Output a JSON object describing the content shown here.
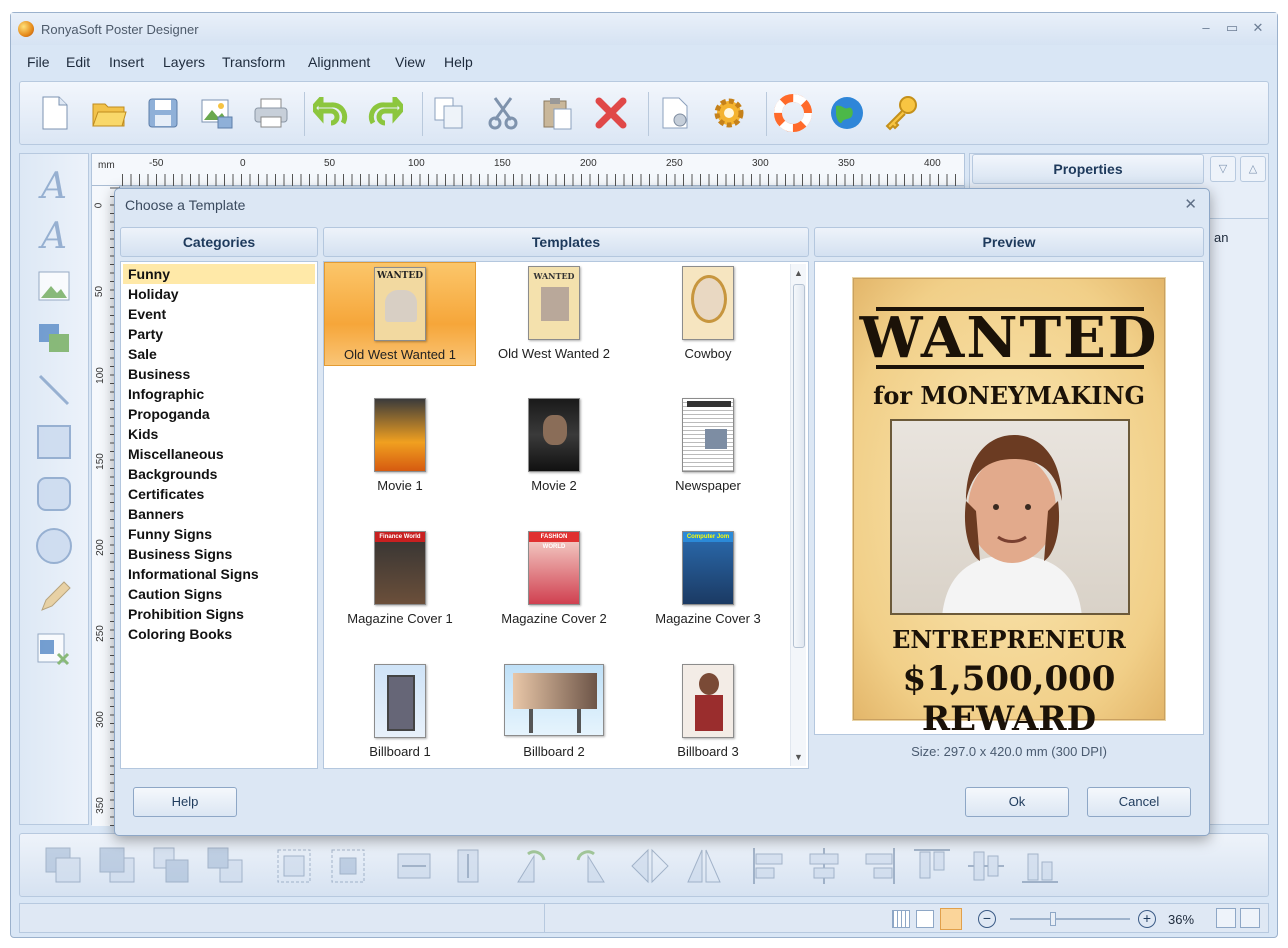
{
  "app": {
    "title": "RonyaSoft Poster Designer"
  },
  "menu": [
    "File",
    "Edit",
    "Insert",
    "Layers",
    "Transform",
    "Alignment",
    "View",
    "Help"
  ],
  "toolbar": {
    "icons": [
      "new-document-icon",
      "open-folder-icon",
      "save-icon",
      "export-image-icon",
      "print-icon",
      "undo-icon",
      "redo-icon",
      "copy-icon",
      "cut-icon",
      "paste-icon",
      "delete-icon",
      "page-settings-icon",
      "options-gear-icon",
      "help-lifebuoy-icon",
      "web-globe-icon",
      "register-key-icon"
    ]
  },
  "ruler": {
    "unit": "mm",
    "h_labels": [
      "-50",
      "0",
      "50",
      "100",
      "150",
      "200",
      "250",
      "300",
      "350",
      "400"
    ],
    "v_labels": [
      "0",
      "50",
      "100",
      "150",
      "200",
      "250",
      "300",
      "350"
    ]
  },
  "properties": {
    "title": "Properties",
    "fragment": "an"
  },
  "dialog": {
    "title": "Choose a Template",
    "headers": {
      "categories": "Categories",
      "templates": "Templates",
      "preview": "Preview"
    },
    "categories": [
      "Funny",
      "Holiday",
      "Event",
      "Party",
      "Sale",
      "Business",
      "Infographic",
      "Propoganda",
      "Kids",
      "Miscellaneous",
      "Backgrounds",
      "Certificates",
      "Banners",
      "Funny Signs",
      "Business Signs",
      "Informational Signs",
      "Caution Signs",
      "Prohibition Signs",
      "Coloring Books"
    ],
    "selected_category": "Funny",
    "templates": [
      "Old West Wanted 1",
      "Old West Wanted 2",
      "Cowboy",
      "Movie 1",
      "Movie 2",
      "Newspaper",
      "Magazine Cover 1",
      "Magazine Cover 2",
      "Magazine Cover 3",
      "Billboard 1",
      "Billboard 2",
      "Billboard 3"
    ],
    "selected_template": "Old West Wanted 1",
    "preview": {
      "headline": "WANTED",
      "sub": "for MONEYMAKING",
      "occupation": "ENTREPRENEUR",
      "reward": "$1,500,000 REWARD"
    },
    "thumb_text": {
      "wanted": "WANTED",
      "finance": "Finance World",
      "fashion": "FASHION WORLD",
      "computer": "Computer Jom"
    },
    "size_label": "Size: 297.0 x 420.0 mm (300 DPI)",
    "buttons": {
      "help": "Help",
      "ok": "Ok",
      "cancel": "Cancel"
    }
  },
  "status": {
    "zoom": "36%"
  },
  "colors": {
    "accent": "#f6a63a",
    "selection": "#ffe9a8",
    "panel": "#dce7f4"
  }
}
